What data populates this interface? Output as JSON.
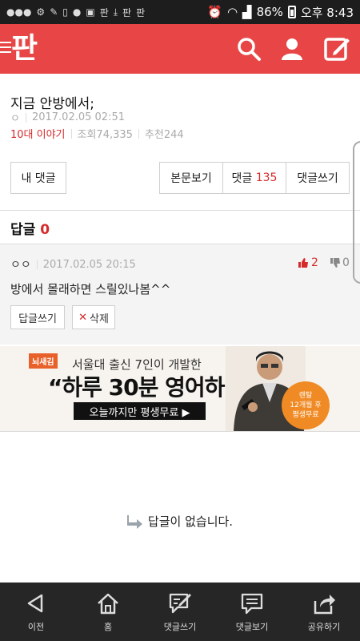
{
  "statusbar": {
    "battery": "86%",
    "time": "오후 8:43",
    "notif_icons": [
      "message-icon",
      "settings-icon",
      "tools-icon",
      "phone-icon",
      "kakaotalk-icon",
      "image-icon",
      "download-icon",
      "pann-icon",
      "pann-icon",
      "alarm-icon",
      "wifi-icon",
      "signal-icon"
    ]
  },
  "header": {
    "logo": "판",
    "icons": [
      "search-icon",
      "user-icon",
      "write-icon"
    ],
    "accent": "#e84646"
  },
  "post": {
    "title": "지금 안방에서;",
    "author": "ㅇ",
    "date": "2017.02.05 02:51",
    "category": "10대 이야기",
    "views": "조회74,335",
    "recommends": "추천244"
  },
  "actions": {
    "my_comments": "내 댓글",
    "view_post": "본문보기",
    "comments_label": "댓글",
    "comments_count": "135",
    "write_comment": "댓글쓰기"
  },
  "replies": {
    "label": "답글",
    "count": "0"
  },
  "comment": {
    "author": "ㅇㅇ",
    "date": "2017.02.05 20:15",
    "likes": "2",
    "dislikes": "0",
    "text": "방에서 몰래하면 스릴있나봄^^",
    "reply_btn": "답글쓰기",
    "delete_btn": "삭제"
  },
  "ad": {
    "brand": "뇌새김",
    "line1": "서울대 출신 7인이 개발한",
    "line2": "“하루 30분 영어하라”",
    "cta": "오늘까지만 평생무료 ▶",
    "badge_l1": "렌탈",
    "badge_l2": "12개월 후",
    "badge_l3": "평생무료"
  },
  "empty_message": "답글이 없습니다.",
  "bottomnav": [
    {
      "label": "이전",
      "icon": "back-icon"
    },
    {
      "label": "홈",
      "icon": "home-icon"
    },
    {
      "label": "댓글쓰기",
      "icon": "comment-write-icon"
    },
    {
      "label": "댓글보기",
      "icon": "comment-view-icon"
    },
    {
      "label": "공유하기",
      "icon": "share-icon"
    }
  ]
}
